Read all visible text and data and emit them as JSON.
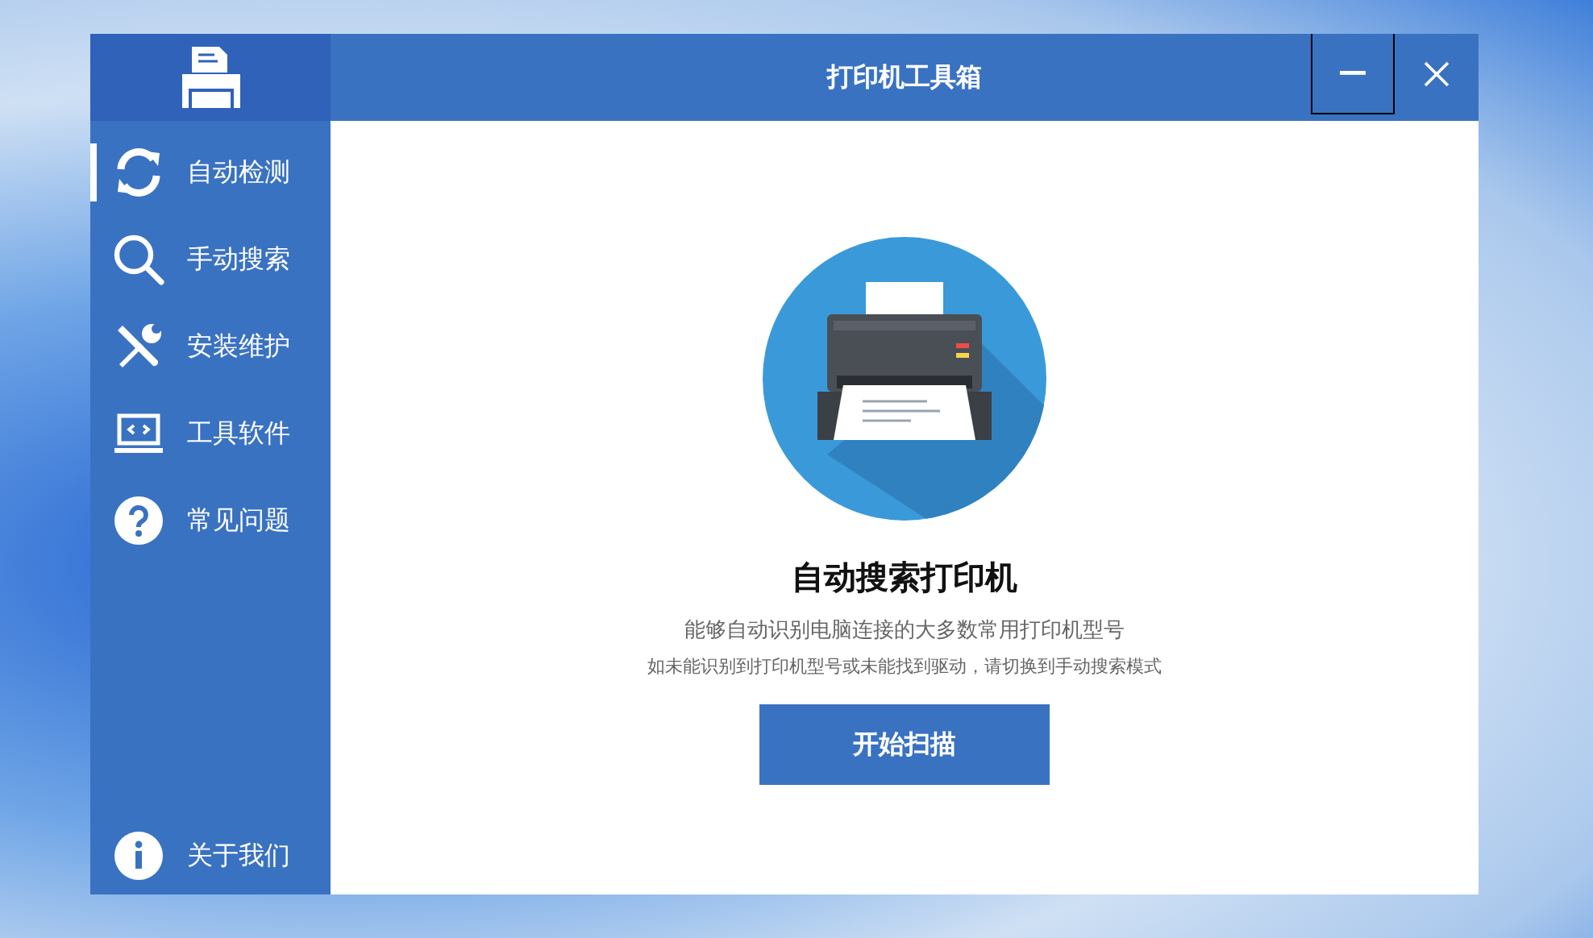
{
  "window": {
    "title": "打印机工具箱"
  },
  "sidebar": {
    "items": [
      {
        "label": "自动检测",
        "selected": true
      },
      {
        "label": "手动搜索",
        "selected": false
      },
      {
        "label": "安装维护",
        "selected": false
      },
      {
        "label": "工具软件",
        "selected": false
      },
      {
        "label": "常见问题",
        "selected": false
      }
    ],
    "footer": {
      "label": "关于我们"
    }
  },
  "main": {
    "heading": "自动搜索打印机",
    "description": "能够自动识别电脑连接的大多数常用打印机型号",
    "hint": "如未能识别到打印机型号或未能找到驱动，请切换到手动搜索模式",
    "button": "开始扫描"
  }
}
